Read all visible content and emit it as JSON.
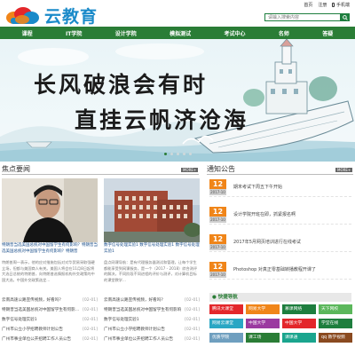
{
  "logo": {
    "text": "云教育"
  },
  "top_links": [
    "首页",
    "注册",
    "手机端"
  ],
  "search": {
    "placeholder": "请输入搜索内容"
  },
  "nav": [
    "课程",
    "IT学院",
    "设计学院",
    "模拟测试",
    "考试中心",
    "名师",
    "答疑"
  ],
  "banner": {
    "line1": "长风破浪会有时",
    "line2": "直挂云帆济沧海"
  },
  "focus": {
    "title": "焦点要闻",
    "more": "MORE+",
    "left_caption": "特朗普当选美国总统对中国留学生有何影响？特朗普当选美国总统对中国留学生有何影响？特朗普",
    "left_summary": "特朗普周一表示，他的应对措施包括对对华贸易采取强硬立场，但都与美国商人有关。美国人将会在11月8日起将大选日总统的特朗普，向特朗普选情报机构外交政策的中国大选，中国外交政策选定...",
    "right_caption": "数字信号处理实验1 数字信号处理实验1 数字信号处理实验1",
    "right_summary": "盘点网课导航：是有代理服务器测试和管理，让每个学生都能享受到网课服务，是一个（2017 - 2018）综合测评的解决，不同阶段不同进程的评价与测评，对计算机目标的课堂教学...",
    "left_news": [
      {
        "title": "云南高速公路宣传视频，好看吗?",
        "date": "[02-01]"
      },
      {
        "title": "特朗普当选美国总统对中国留学生有何影响？",
        "date": "[02-01]"
      },
      {
        "title": "数字信号处理实验1",
        "date": "[02-01]"
      },
      {
        "title": "广州市公立小学招聘教师计划公告",
        "date": "[02-01]"
      },
      {
        "title": "广州市事业单位公开招聘工作人员公告",
        "date": "[02-01]"
      }
    ],
    "right_news": [
      {
        "title": "云南高速公路宣传视频，好看吗?",
        "date": "[02-01]"
      },
      {
        "title": "特朗普当选美国总统对中国留学生有何影响",
        "date": "[02-01]"
      },
      {
        "title": "数字信号处理实验1",
        "date": "[02-01]"
      },
      {
        "title": "广州市公立小学招聘教师计划公告",
        "date": "[02-01]"
      },
      {
        "title": "广州市事业单位公开招聘工作人员公告",
        "date": "[02-01]"
      }
    ]
  },
  "notices": {
    "title": "通知公告",
    "more": "MORE+",
    "items": [
      {
        "day": "12",
        "month": "2017-10",
        "text": "期末考试下周五下午开始"
      },
      {
        "day": "12",
        "month": "2017-10",
        "text": "设计学院开班在即，抓紧报名啊"
      },
      {
        "day": "12",
        "month": "2017-10",
        "text": "2017年5月网页培训进行在线考试"
      },
      {
        "day": "12",
        "month": "2017-10",
        "text": "Photoshop 对真正零基础转播教程开课了"
      }
    ]
  },
  "quick": {
    "title": "快捷导航",
    "items": [
      {
        "label": "腾讯大课堂",
        "color": "#e3272b"
      },
      {
        "label": "网易大学",
        "color": "#f08519"
      },
      {
        "label": "慕课网络",
        "color": "#1e7e3e"
      },
      {
        "label": "天下网校",
        "color": "#5bb75b"
      },
      {
        "label": "网易云课堂",
        "color": "#2aa7c4"
      },
      {
        "label": "中国大学",
        "color": "#9b3aa0"
      },
      {
        "label": "中国大学",
        "color": "#e3272b"
      },
      {
        "label": "学堂在线",
        "color": "#1e7e3e"
      },
      {
        "label": "优质学院",
        "color": "#6f9fbf"
      },
      {
        "label": "课工场",
        "color": "#2a7d36"
      },
      {
        "label": "课课通",
        "color": "#1aa58e"
      },
      {
        "label": "qq 教学视频",
        "color": "#8a4a20"
      }
    ]
  }
}
